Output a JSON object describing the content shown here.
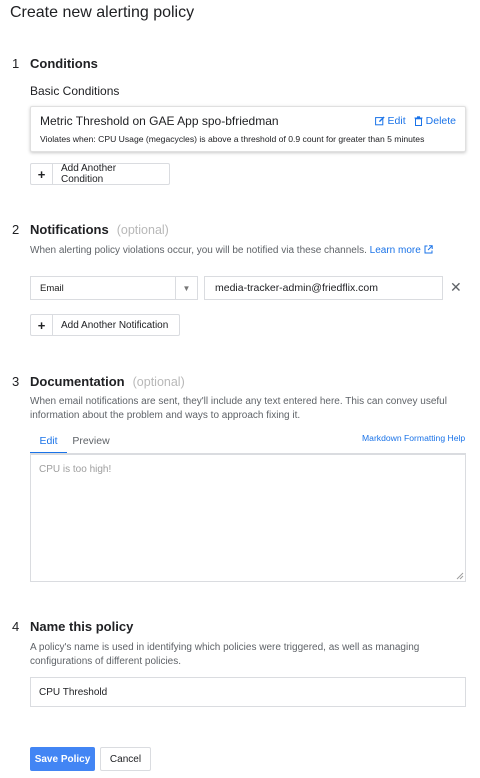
{
  "page": {
    "title": "Create new alerting policy"
  },
  "conditions": {
    "number": "1",
    "title": "Conditions",
    "subtitle": "Basic Conditions",
    "card": {
      "title": "Metric Threshold on GAE App spo-bfriedman",
      "edit_label": "Edit",
      "delete_label": "Delete",
      "violates": "Violates when: CPU Usage (megacycles) is above a threshold of 0.9 count for greater than 5 minutes"
    },
    "add_label": "Add Another Condition"
  },
  "notifications": {
    "number": "2",
    "title": "Notifications",
    "optional": "(optional)",
    "description": "When alerting policy violations occur, you will be notified via these channels.",
    "learn_more": "Learn more",
    "channel_type": "Email",
    "email_value": "media-tracker-admin@friedflix.com",
    "add_label": "Add Another Notification"
  },
  "documentation": {
    "number": "3",
    "title": "Documentation",
    "optional": "(optional)",
    "description_line1": "When email notifications are sent, they'll include any text entered here. This can convey useful",
    "description_line2": "information about the problem and ways to approach fixing it.",
    "tabs": [
      "Edit",
      "Preview"
    ],
    "help_link": "Markdown Formatting Help",
    "content": "CPU is too high!"
  },
  "name_policy": {
    "number": "4",
    "title": "Name this policy",
    "description_line1": "A policy's name is used in identifying which policies were triggered, as well as managing",
    "description_line2": "configurations of different policies.",
    "value": "CPU Threshold"
  },
  "actions": {
    "save_label": "Save Policy",
    "cancel_label": "Cancel"
  },
  "colors": {
    "accent": "#1a73e8",
    "primary_button": "#4285f4"
  }
}
